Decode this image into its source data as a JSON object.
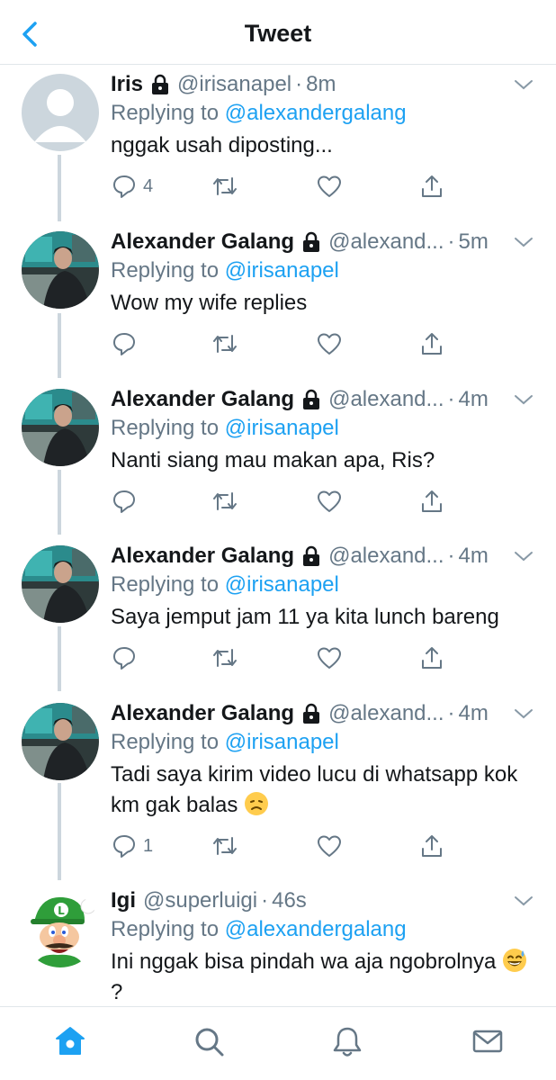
{
  "header": {
    "title": "Tweet"
  },
  "replying_label": "Replying to",
  "tweets": [
    {
      "name": "Iris",
      "locked": true,
      "handle": "@irisanapel",
      "time": "8m",
      "reply_to": "@alexandergalang",
      "text": "nggak usah diposting...",
      "reply_count": "4",
      "avatar": "default-avatar"
    },
    {
      "name": "Alexander Galang",
      "locked": true,
      "handle": "@alexand...",
      "time": "5m",
      "reply_to": "@irisanapel",
      "text": "Wow my wife replies",
      "reply_count": "",
      "avatar": "photo-avatar"
    },
    {
      "name": "Alexander Galang",
      "locked": true,
      "handle": "@alexand...",
      "time": "4m",
      "reply_to": "@irisanapel",
      "text": "Nanti siang mau makan apa, Ris?",
      "reply_count": "",
      "avatar": "photo-avatar"
    },
    {
      "name": "Alexander Galang",
      "locked": true,
      "handle": "@alexand...",
      "time": "4m",
      "reply_to": "@irisanapel",
      "text": "Saya jemput jam 11 ya kita lunch bareng",
      "reply_count": "",
      "avatar": "photo-avatar"
    },
    {
      "name": "Alexander Galang",
      "locked": true,
      "handle": "@alexand...",
      "time": "4m",
      "reply_to": "@irisanapel",
      "text": "Tadi saya kirim video lucu di whatsapp kok km gak balas",
      "emoji": "disappointed-face",
      "reply_count": "1",
      "avatar": "photo-avatar"
    },
    {
      "name": "Igi",
      "locked": false,
      "handle": "@superluigi",
      "time": "46s",
      "reply_to": "@alexandergalang",
      "text": "Ini nggak bisa pindah wa aja ngobrolnya",
      "emoji": "grinning-sweat-face",
      "text_after_emoji": "?",
      "reply_count": "",
      "avatar": "luigi-avatar"
    }
  ],
  "colors": {
    "accent": "#1da1f2",
    "muted": "#657786",
    "text": "#14171a",
    "divider": "#e1e6ea",
    "thread_line": "#ccd6dd"
  },
  "tabbar": {
    "items": [
      "home-icon",
      "search-icon",
      "notifications-icon",
      "messages-icon"
    ],
    "active": "home-icon"
  }
}
